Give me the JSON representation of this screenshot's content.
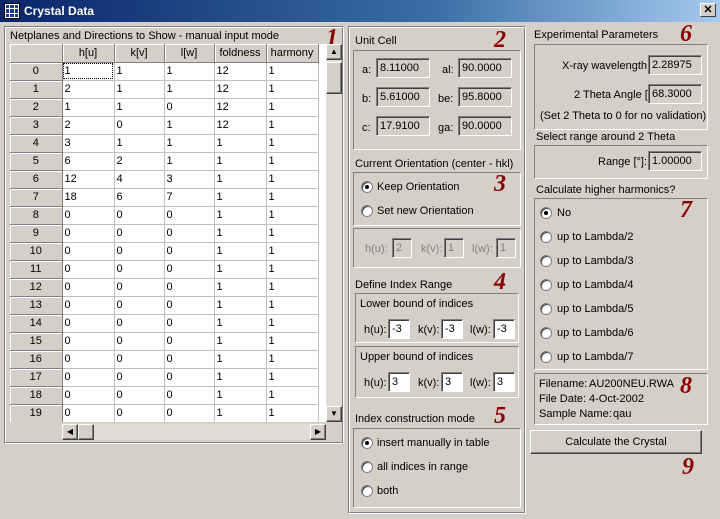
{
  "window": {
    "title": "Crystal Data",
    "close_glyph": "✕"
  },
  "grid_panel": {
    "heading": "Netplanes and Directions to Show - manual input mode",
    "number": "1",
    "columns": [
      "h[u]",
      "k[v]",
      "l[w]",
      "foldness",
      "harmony"
    ],
    "rows": [
      {
        "n": "0",
        "c": [
          "1",
          "1",
          "1",
          "12",
          "1"
        ]
      },
      {
        "n": "1",
        "c": [
          "2",
          "1",
          "1",
          "12",
          "1"
        ]
      },
      {
        "n": "2",
        "c": [
          "1",
          "1",
          "0",
          "12",
          "1"
        ]
      },
      {
        "n": "3",
        "c": [
          "2",
          "0",
          "1",
          "12",
          "1"
        ]
      },
      {
        "n": "4",
        "c": [
          "3",
          "1",
          "1",
          "1",
          "1"
        ]
      },
      {
        "n": "5",
        "c": [
          "6",
          "2",
          "1",
          "1",
          "1"
        ]
      },
      {
        "n": "6",
        "c": [
          "12",
          "4",
          "3",
          "1",
          "1"
        ]
      },
      {
        "n": "7",
        "c": [
          "18",
          "6",
          "7",
          "1",
          "1"
        ]
      },
      {
        "n": "8",
        "c": [
          "0",
          "0",
          "0",
          "1",
          "1"
        ]
      },
      {
        "n": "9",
        "c": [
          "0",
          "0",
          "0",
          "1",
          "1"
        ]
      },
      {
        "n": "10",
        "c": [
          "0",
          "0",
          "0",
          "1",
          "1"
        ]
      },
      {
        "n": "11",
        "c": [
          "0",
          "0",
          "0",
          "1",
          "1"
        ]
      },
      {
        "n": "12",
        "c": [
          "0",
          "0",
          "0",
          "1",
          "1"
        ]
      },
      {
        "n": "13",
        "c": [
          "0",
          "0",
          "0",
          "1",
          "1"
        ]
      },
      {
        "n": "14",
        "c": [
          "0",
          "0",
          "0",
          "1",
          "1"
        ]
      },
      {
        "n": "15",
        "c": [
          "0",
          "0",
          "0",
          "1",
          "1"
        ]
      },
      {
        "n": "16",
        "c": [
          "0",
          "0",
          "0",
          "1",
          "1"
        ]
      },
      {
        "n": "17",
        "c": [
          "0",
          "0",
          "0",
          "1",
          "1"
        ]
      },
      {
        "n": "18",
        "c": [
          "0",
          "0",
          "0",
          "1",
          "1"
        ]
      },
      {
        "n": "19",
        "c": [
          "0",
          "0",
          "0",
          "1",
          "1"
        ]
      }
    ]
  },
  "unit_cell": {
    "heading": "Unit Cell",
    "number": "2",
    "a_label": "a:",
    "a": "8.11000",
    "b_label": "b:",
    "b": "5.61000",
    "c_label": "c:",
    "c": "17.9100",
    "al_label": "al:",
    "al": "90.0000",
    "be_label": "be:",
    "be": "95.8000",
    "ga_label": "ga:",
    "ga": "90.0000"
  },
  "orientation": {
    "heading": "Current Orientation (center - hkl)",
    "number": "3",
    "keep_label": "Keep Orientation",
    "set_label": "Set new Orientation",
    "h_label": "h(u):",
    "h": "2",
    "k_label": "k(v):",
    "k": "1",
    "l_label": "l(w):",
    "l": "1"
  },
  "index_range": {
    "heading": "Define Index Range",
    "number": "4",
    "lower_heading": "Lower bound of indices",
    "upper_heading": "Upper bound of indices",
    "h_label": "h(u):",
    "k_label": "k(v):",
    "l_label": "l(w):",
    "lower_h": "-3",
    "lower_k": "-3",
    "lower_l": "-3",
    "upper_h": "3",
    "upper_k": "3",
    "upper_l": "3"
  },
  "index_mode": {
    "heading": "Index construction mode",
    "number": "5",
    "opt_manual": "insert manually in table",
    "opt_all": "all indices in range",
    "opt_both": "both"
  },
  "experimental": {
    "heading": "Experimental Parameters",
    "number": "6",
    "wavelength_label": "X-ray wavelength:",
    "wavelength": "2.28975",
    "theta_label": "2 Theta Angle [°]:",
    "theta": "68.3000",
    "theta_note": "(Set 2 Theta to 0 for no validation)",
    "range_heading": "Select range around 2 Theta",
    "range_label": "Range [°]:",
    "range": "1.00000"
  },
  "harmonics": {
    "heading": "Calculate higher harmonics?",
    "number": "7",
    "options": [
      "No",
      "up to Lambda/2",
      "up to Lambda/3",
      "up to Lambda/4",
      "up to Lambda/5",
      "up to Lambda/6",
      "up to Lambda/7"
    ]
  },
  "file_info": {
    "number": "8",
    "filename_label": "Filename:",
    "filename": "AU200NEU.RWA",
    "date_label": "File Date:",
    "date": "4-Oct-2002",
    "sample_label": "Sample Name:",
    "sample": "qau"
  },
  "calculate": {
    "label": "Calculate the Crystal",
    "number": "9"
  }
}
